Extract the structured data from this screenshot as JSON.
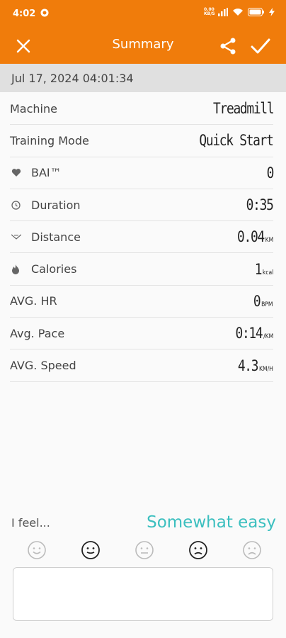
{
  "status_bar": {
    "time": "4:02",
    "network_text_top": "0.00",
    "network_text_bottom": "KB/S"
  },
  "app_bar": {
    "title": "Summary"
  },
  "date": "Jul 17, 2024 04:01:34",
  "rows": [
    {
      "label": "Machine",
      "value": "Treadmill",
      "unit": "",
      "icon": ""
    },
    {
      "label": "Training Mode",
      "value": "Quick Start",
      "unit": "",
      "icon": ""
    },
    {
      "label": "BAI™",
      "value": "0",
      "unit": "",
      "icon": "heart-icon"
    },
    {
      "label": "Duration",
      "value": "0:35",
      "unit": "",
      "icon": "clock-icon"
    },
    {
      "label": "Distance",
      "value": "0.04",
      "unit": "KM",
      "icon": "road-icon"
    },
    {
      "label": "Calories",
      "value": "1",
      "unit": "kcal",
      "icon": "flame-icon"
    },
    {
      "label": "AVG. HR",
      "value": "0",
      "unit": "BPM",
      "icon": ""
    },
    {
      "label": "Avg. Pace",
      "value": "0:14",
      "unit": "/KM",
      "icon": ""
    },
    {
      "label": "AVG. Speed",
      "value": "4.3",
      "unit": "KM/H",
      "icon": ""
    }
  ],
  "feel": {
    "label": "I feel...",
    "selected": "Somewhat easy"
  },
  "colors": {
    "accent": "#f07c0b",
    "rating": "#3bbfbf"
  }
}
